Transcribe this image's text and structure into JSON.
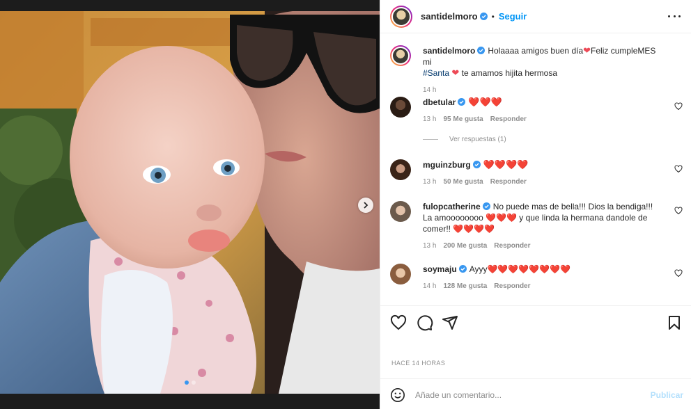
{
  "post": {
    "username": "santidelmoro",
    "follow_label": "Seguir",
    "separator": "•",
    "caption": {
      "username": "santidelmoro",
      "text_a": "Holaaaa amigos buen día",
      "text_b": "Feliz cumpleMES mi",
      "hashtag": "#Santa",
      "text_c": "te amamos hijita hermosa",
      "time": "14 h"
    },
    "comments": [
      {
        "username": "dbetular",
        "text": "❤️❤️❤️",
        "time": "13 h",
        "likes": "95 Me gusta",
        "reply": "Responder",
        "view_replies": "Ver respuestas (1)"
      },
      {
        "username": "mguinzburg",
        "text": "❤️❤️❤️❤️",
        "time": "13 h",
        "likes": "50 Me gusta",
        "reply": "Responder"
      },
      {
        "username": "fulopcatherine",
        "text": "No puede mas de bella!!! Dios la bendiga!!! La amoooooooo ❤️❤️❤️ y que linda la hermana dandole de comer!! ❤️❤️❤️❤️",
        "time": "13 h",
        "likes": "200 Me gusta",
        "reply": "Responder"
      },
      {
        "username": "soymaju",
        "text": "Ayyy❤️❤️❤️❤️❤️❤️❤️❤️",
        "time": "14 h",
        "likes": "128 Me gusta",
        "reply": "Responder"
      }
    ],
    "timestamp": "HACE 14 HORAS",
    "add_comment_placeholder": "Añade un comentario...",
    "publish_label": "Publicar",
    "carousel": {
      "count": 2,
      "active": 1
    }
  },
  "colors": {
    "accent": "#0095f6",
    "verified": "#3897f0",
    "heart": "#ed4956",
    "hashtag": "#00376b",
    "muted": "#8e8e8e"
  },
  "icons": [
    "verified-icon",
    "more-options-icon",
    "heart-icon",
    "comment-icon",
    "share-icon",
    "bookmark-icon",
    "emoji-icon",
    "chevron-right-icon"
  ]
}
